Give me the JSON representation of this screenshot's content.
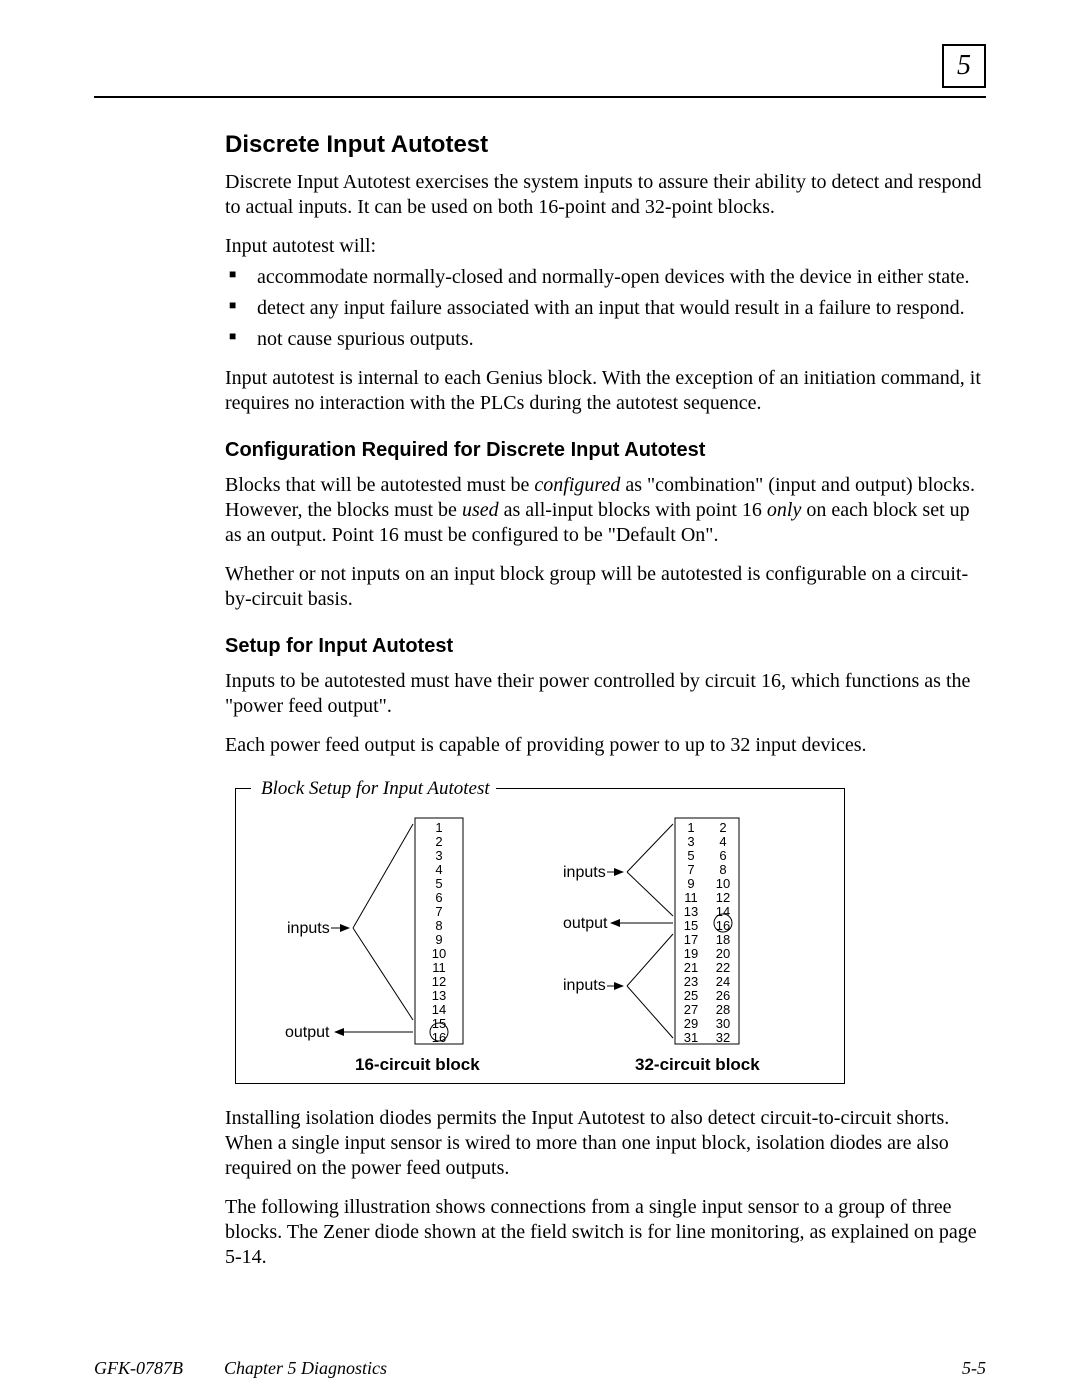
{
  "header": {
    "chapter_number": "5"
  },
  "section": {
    "title": "Discrete Input Autotest",
    "intro": "Discrete Input Autotest exercises the system inputs to assure their ability to detect and respond to actual inputs.  It can be used on both 16-point and 32-point blocks.",
    "lead": "Input autotest will:",
    "bullets": {
      "b1": "accommodate normally-closed and normally-open devices with the device in either state.",
      "b2": "detect any input failure associated with an input that would result in a failure to respond.",
      "b3": "not cause spurious outputs."
    },
    "after_bullets": "Input autotest is internal to each Genius block. With the exception of an initiation command, it requires no interaction with the PLCs during the autotest sequence."
  },
  "config": {
    "title": "Configuration Required for Discrete Input Autotest",
    "p1_a": "Blocks that will be autotested must be ",
    "p1_i1": "configured",
    "p1_b": " as \"combination\" (input and output) blocks. However, the blocks must be ",
    "p1_i2": "used",
    "p1_c": " as all-input blocks with point 16 ",
    "p1_i3": "only",
    "p1_d": " on each block set up as an output. Point 16 must be configured to be \"Default On\".",
    "p2": "Whether or not inputs on an input block group will be autotested is configurable on a circuit-by-circuit basis."
  },
  "setup": {
    "title": "Setup for Input Autotest",
    "p1": "Inputs to be autotested must have their power controlled by circuit 16, which functions as the \"power feed output\".",
    "p2": "Each power feed output is capable of providing power to up to 32 input devices."
  },
  "figure": {
    "title": "Block Setup for Input Autotest",
    "labels": {
      "inputs": "inputs",
      "output": "output",
      "cap16": "16-circuit block",
      "cap32": "32-circuit block"
    },
    "block16": [
      "1",
      "2",
      "3",
      "4",
      "5",
      "6",
      "7",
      "8",
      "9",
      "10",
      "11",
      "12",
      "13",
      "14",
      "15",
      "16"
    ],
    "block32_left": [
      "1",
      "3",
      "5",
      "7",
      "9",
      "11",
      "13",
      "15",
      "17",
      "19",
      "21",
      "23",
      "25",
      "27",
      "29",
      "31"
    ],
    "block32_right": [
      "2",
      "4",
      "6",
      "8",
      "10",
      "12",
      "14",
      "16",
      "18",
      "20",
      "22",
      "24",
      "26",
      "28",
      "30",
      "32"
    ]
  },
  "after_figure": {
    "p1": "Installing isolation diodes permits the Input Autotest to also detect circuit-to-circuit shorts. When a single input sensor is wired to more than one input block, isolation diodes are also required on the power feed outputs.",
    "p2": "The following illustration shows connections from a single input sensor to a group of three blocks. The Zener diode shown at the field switch is for line monitoring, as explained on page 5-14."
  },
  "footer": {
    "left": "GFK-0787B",
    "mid": "Chapter 5  Diagnostics",
    "right": "5-5"
  }
}
